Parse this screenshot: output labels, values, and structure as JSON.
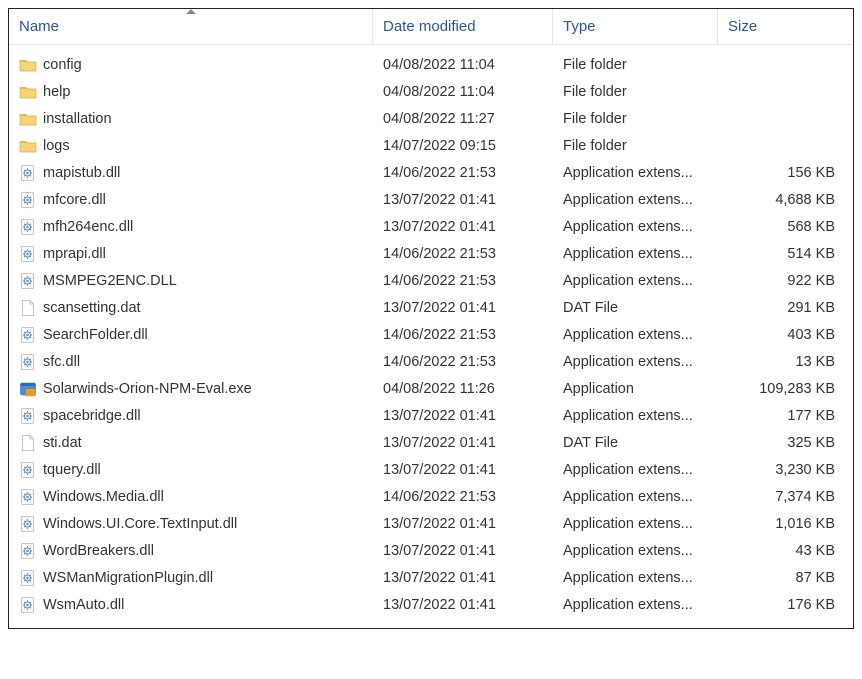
{
  "columns": {
    "name": "Name",
    "date": "Date modified",
    "type": "Type",
    "size": "Size"
  },
  "sort": {
    "column": "name",
    "direction": "asc"
  },
  "items": [
    {
      "icon": "folder",
      "name": "config",
      "date": "04/08/2022 11:04",
      "type": "File folder",
      "size": ""
    },
    {
      "icon": "folder",
      "name": "help",
      "date": "04/08/2022 11:04",
      "type": "File folder",
      "size": ""
    },
    {
      "icon": "folder",
      "name": "installation",
      "date": "04/08/2022 11:27",
      "type": "File folder",
      "size": ""
    },
    {
      "icon": "folder",
      "name": "logs",
      "date": "14/07/2022 09:15",
      "type": "File folder",
      "size": ""
    },
    {
      "icon": "dll",
      "name": "mapistub.dll",
      "date": "14/06/2022 21:53",
      "type": "Application extens...",
      "size": "156 KB"
    },
    {
      "icon": "dll",
      "name": "mfcore.dll",
      "date": "13/07/2022 01:41",
      "type": "Application extens...",
      "size": "4,688 KB"
    },
    {
      "icon": "dll",
      "name": "mfh264enc.dll",
      "date": "13/07/2022 01:41",
      "type": "Application extens...",
      "size": "568 KB"
    },
    {
      "icon": "dll",
      "name": "mprapi.dll",
      "date": "14/06/2022 21:53",
      "type": "Application extens...",
      "size": "514 KB"
    },
    {
      "icon": "dll",
      "name": "MSMPEG2ENC.DLL",
      "date": "14/06/2022 21:53",
      "type": "Application extens...",
      "size": "922 KB"
    },
    {
      "icon": "file",
      "name": "scansetting.dat",
      "date": "13/07/2022 01:41",
      "type": "DAT File",
      "size": "291 KB"
    },
    {
      "icon": "dll",
      "name": "SearchFolder.dll",
      "date": "14/06/2022 21:53",
      "type": "Application extens...",
      "size": "403 KB"
    },
    {
      "icon": "dll",
      "name": "sfc.dll",
      "date": "14/06/2022 21:53",
      "type": "Application extens...",
      "size": "13 KB"
    },
    {
      "icon": "exe",
      "name": "Solarwinds-Orion-NPM-Eval.exe",
      "date": "04/08/2022 11:26",
      "type": "Application",
      "size": "109,283 KB"
    },
    {
      "icon": "dll",
      "name": "spacebridge.dll",
      "date": "13/07/2022 01:41",
      "type": "Application extens...",
      "size": "177 KB"
    },
    {
      "icon": "file",
      "name": "sti.dat",
      "date": "13/07/2022 01:41",
      "type": "DAT File",
      "size": "325 KB"
    },
    {
      "icon": "dll",
      "name": "tquery.dll",
      "date": "13/07/2022 01:41",
      "type": "Application extens...",
      "size": "3,230 KB"
    },
    {
      "icon": "dll",
      "name": "Windows.Media.dll",
      "date": "14/06/2022 21:53",
      "type": "Application extens...",
      "size": "7,374 KB"
    },
    {
      "icon": "dll",
      "name": "Windows.UI.Core.TextInput.dll",
      "date": "13/07/2022 01:41",
      "type": "Application extens...",
      "size": "1,016 KB"
    },
    {
      "icon": "dll",
      "name": "WordBreakers.dll",
      "date": "13/07/2022 01:41",
      "type": "Application extens...",
      "size": "43 KB"
    },
    {
      "icon": "dll",
      "name": "WSManMigrationPlugin.dll",
      "date": "13/07/2022 01:41",
      "type": "Application extens...",
      "size": "87 KB"
    },
    {
      "icon": "dll",
      "name": "WsmAuto.dll",
      "date": "13/07/2022 01:41",
      "type": "Application extens...",
      "size": "176 KB"
    }
  ]
}
